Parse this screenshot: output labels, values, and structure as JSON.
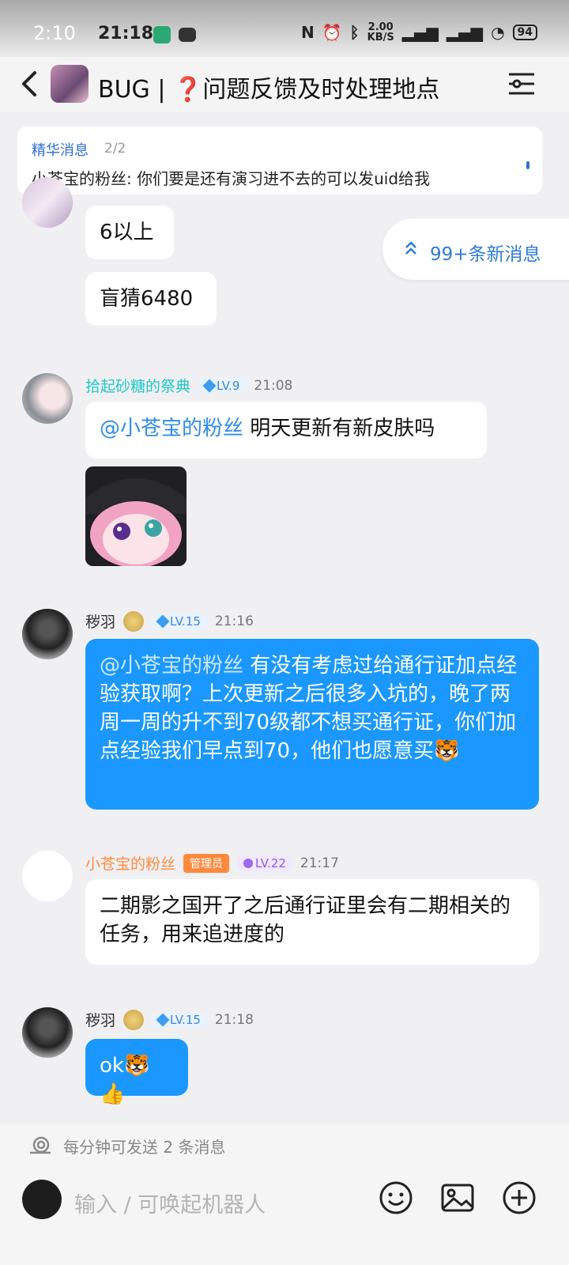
{
  "status_bar": {
    "time_left": "2:10",
    "time": "21:18",
    "speed": "2.00",
    "speed_unit": "KB/S",
    "battery": "94"
  },
  "header": {
    "title": "BUG | ❓问题反馈及时处理地点"
  },
  "pinned": {
    "label": "精华消息",
    "count": "2/2",
    "text": "小苍宝的粉丝: 你们要是还有演习进不去的可以发uid给我"
  },
  "new_messages": {
    "text": "99+条新消息"
  },
  "messages": [
    {
      "text": "6以上"
    },
    {
      "text": "盲猜6480"
    },
    {
      "sender": "拾起砂糖的祭典",
      "level": "LV.9",
      "time": "21:08",
      "mention": "@小苍宝的粉丝",
      "text": " 明天更新有新皮肤吗"
    },
    {
      "sender": "秽羽",
      "level": "LV.15",
      "time": "21:16",
      "mention": "@小苍宝的粉丝",
      "text": " 有没有考虑过给通行证加点经验获取啊？上次更新之后很多入坑的，晚了两周一周的升不到70级都不想买通行证，你们加点经验我们早点到70，他们也愿意买🐯"
    },
    {
      "sender": "小苍宝的粉丝",
      "role": "管理员",
      "level": "LV.22",
      "time": "21:17",
      "text": "二期影之国开了之后通行证里会有二期相关的任务，用来追进度的"
    },
    {
      "sender": "秽羽",
      "level": "LV.15",
      "time": "21:18",
      "text": "ok🐯👍"
    }
  ],
  "footer": {
    "limit_text": "每分钟可发送 2 条消息",
    "input_placeholder": "输入 / 可唤起机器人"
  },
  "colors": {
    "accent": "#1a98ff",
    "mention": "#2f8ce8",
    "admin_name": "#ff8a3d",
    "teal_name": "#21c7c7"
  }
}
